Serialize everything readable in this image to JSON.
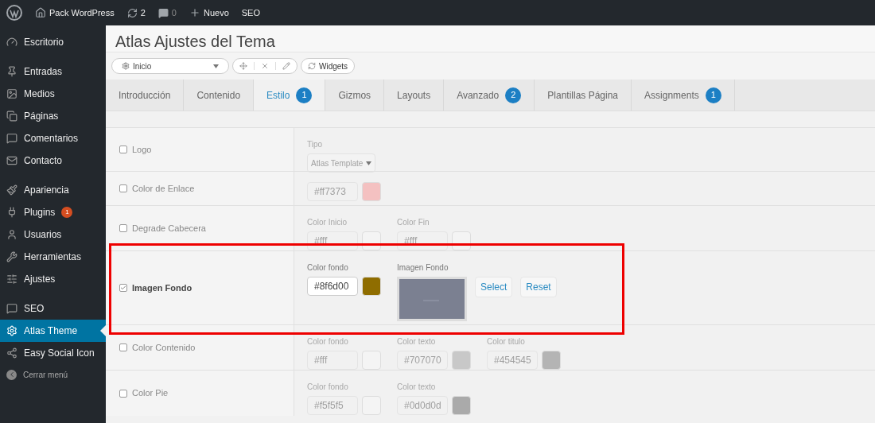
{
  "admin_bar": {
    "site": "Pack WordPress",
    "updates": "2",
    "comments": "0",
    "new": "Nuevo",
    "seo": "SEO"
  },
  "sidebar": {
    "items": [
      {
        "label": "Escritorio",
        "selected": false
      },
      {
        "label": "Entradas",
        "selected": false
      },
      {
        "label": "Medios",
        "selected": false
      },
      {
        "label": "Páginas",
        "selected": false
      },
      {
        "label": "Comentarios",
        "selected": false
      },
      {
        "label": "Contacto",
        "selected": false
      },
      {
        "label": "Apariencia",
        "selected": false
      },
      {
        "label": "Plugins",
        "selected": false,
        "badge": "1"
      },
      {
        "label": "Usuarios",
        "selected": false
      },
      {
        "label": "Herramientas",
        "selected": false
      },
      {
        "label": "Ajustes",
        "selected": false
      },
      {
        "label": "SEO",
        "selected": false
      },
      {
        "label": "Atlas Theme",
        "selected": true
      },
      {
        "label": "Easy Social Icon",
        "selected": false
      }
    ],
    "collapse": "Cerrar menú"
  },
  "page_title": "Atlas Ajustes del Tema",
  "toolbar": {
    "layout_select": "Inicio",
    "widgets": "Widgets"
  },
  "tabs": [
    {
      "label": "Introducción",
      "selected": false
    },
    {
      "label": "Contenido",
      "selected": false
    },
    {
      "label": "Estilo",
      "selected": true,
      "badge": "1"
    },
    {
      "label": "Gizmos",
      "selected": false
    },
    {
      "label": "Layouts",
      "selected": false
    },
    {
      "label": "Avanzado",
      "selected": false,
      "badge": "2"
    },
    {
      "label": "Plantillas Página",
      "selected": false
    },
    {
      "label": "Assignments",
      "selected": false,
      "badge": "1"
    }
  ],
  "rows": [
    {
      "label": "Logo",
      "checked": false,
      "highlighted": false,
      "fields": [
        {
          "kind": "select",
          "label": "Tipo",
          "value": "Atlas Template"
        }
      ]
    },
    {
      "label": "Color de Enlace",
      "checked": false,
      "highlighted": false,
      "fields": [
        {
          "kind": "color",
          "value": "#ff7373",
          "color": "#f4c1c1"
        }
      ]
    },
    {
      "label": "Degrade Cabecera",
      "checked": false,
      "highlighted": false,
      "fields": [
        {
          "kind": "color",
          "label": "Color Inicio",
          "value": "#fff",
          "color": "#f4f4f4"
        },
        {
          "kind": "color",
          "label": "Color Fin",
          "value": "#fff",
          "color": "#f4f4f4"
        }
      ]
    },
    {
      "label": "Imagen Fondo",
      "checked": true,
      "highlighted": true,
      "fields": [
        {
          "kind": "color",
          "label": "Color fondo",
          "value": "#8f6d00",
          "color": "#8f6d00"
        },
        {
          "label": "Imagen Fondo",
          "select": "Select",
          "reset": "Reset"
        }
      ]
    },
    {
      "label": "Color Contenido",
      "checked": false,
      "highlighted": false,
      "fields": [
        {
          "kind": "color",
          "label": "Color fondo",
          "value": "#fff",
          "color": "#f4f4f4"
        },
        {
          "kind": "color",
          "label": "Color texto",
          "value": "#707070",
          "color": "#c8c8c8"
        },
        {
          "kind": "color",
          "label": "Color titulo",
          "value": "#454545",
          "color": "#b4b4b4"
        }
      ]
    },
    {
      "label": "Color Pie",
      "checked": false,
      "highlighted": false,
      "fields": [
        {
          "kind": "color",
          "label": "Color fondo",
          "value": "#f5f5f5",
          "color": "#f4f4f4"
        },
        {
          "kind": "color",
          "label": "Color texto",
          "value": "#0d0d0d",
          "color": "#aaaaaa"
        }
      ]
    }
  ]
}
